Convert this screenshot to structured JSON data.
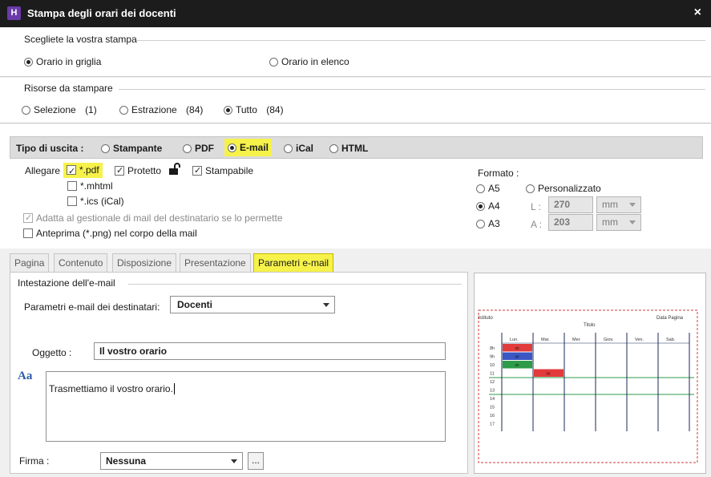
{
  "window": {
    "app_icon": "H",
    "title": "Stampa degli orari dei docenti",
    "close": "×"
  },
  "print_choice": {
    "legend": "Scegliete la vostra stampa",
    "options": [
      {
        "label": "Orario in griglia",
        "selected": true
      },
      {
        "label": "Orario in elenco",
        "selected": false
      }
    ]
  },
  "resources": {
    "legend": "Risorse da stampare",
    "selezione": {
      "label": "Selezione",
      "count": "(1)"
    },
    "estrazione": {
      "label": "Estrazione",
      "count": "(84)"
    },
    "tutto": {
      "label": "Tutto",
      "count": "(84)"
    }
  },
  "output": {
    "label": "Tipo di uscita :",
    "options": [
      "Stampante",
      "PDF",
      "E-mail",
      "iCal",
      "HTML"
    ],
    "selected": "E-mail"
  },
  "attach": {
    "label": "Allegare",
    "pdf": "*.pdf",
    "protetto": "Protetto",
    "stampabile": "Stampabile",
    "mhtml": "*.mhtml",
    "ics": "*.ics (iCal)",
    "adatta": "Adatta al gestionale di mail del destinatario se lo permette",
    "anteprima": "Anteprima (*.png) nel corpo della mail"
  },
  "format": {
    "label": "Formato :",
    "a5": "A5",
    "a4": "A4",
    "a3": "A3",
    "personalizzato": "Personalizzato",
    "l_label": "L :",
    "l_value": "270",
    "a_label": "A :",
    "a_value": "203",
    "unit": "mm"
  },
  "tabs": [
    "Pagina",
    "Contenuto",
    "Disposizione",
    "Presentazione",
    "Parametri e-mail"
  ],
  "email": {
    "legend": "Intestazione dell'e-mail",
    "params_label": "Parametri e-mail dei destinatari:",
    "params_value": "Docenti",
    "subject_label": "Oggetto :",
    "subject_value": "Il vostro orario",
    "font_icon": "Aa",
    "body_value": "Trasmettiamo il vostro orario.",
    "firma_label": "Firma :",
    "firma_value": "Nessuna",
    "more": "..."
  },
  "preview": {
    "istituto": "Istituto",
    "data_pagina": "Data Pagina",
    "titolo": "Titolo",
    "days": [
      "Lun.",
      "Mar.",
      "Mer.",
      "Giov.",
      "Ven.",
      "Sab."
    ],
    "hours": [
      "8h",
      "9h",
      "10",
      "11",
      "12",
      "13",
      "14",
      "15",
      "16",
      "17"
    ],
    "cell_text": "xx"
  },
  "colors": {
    "highlight": "#f6f24a",
    "red": "#e23b3b",
    "blue": "#3b57c4",
    "green": "#2e9b48"
  }
}
